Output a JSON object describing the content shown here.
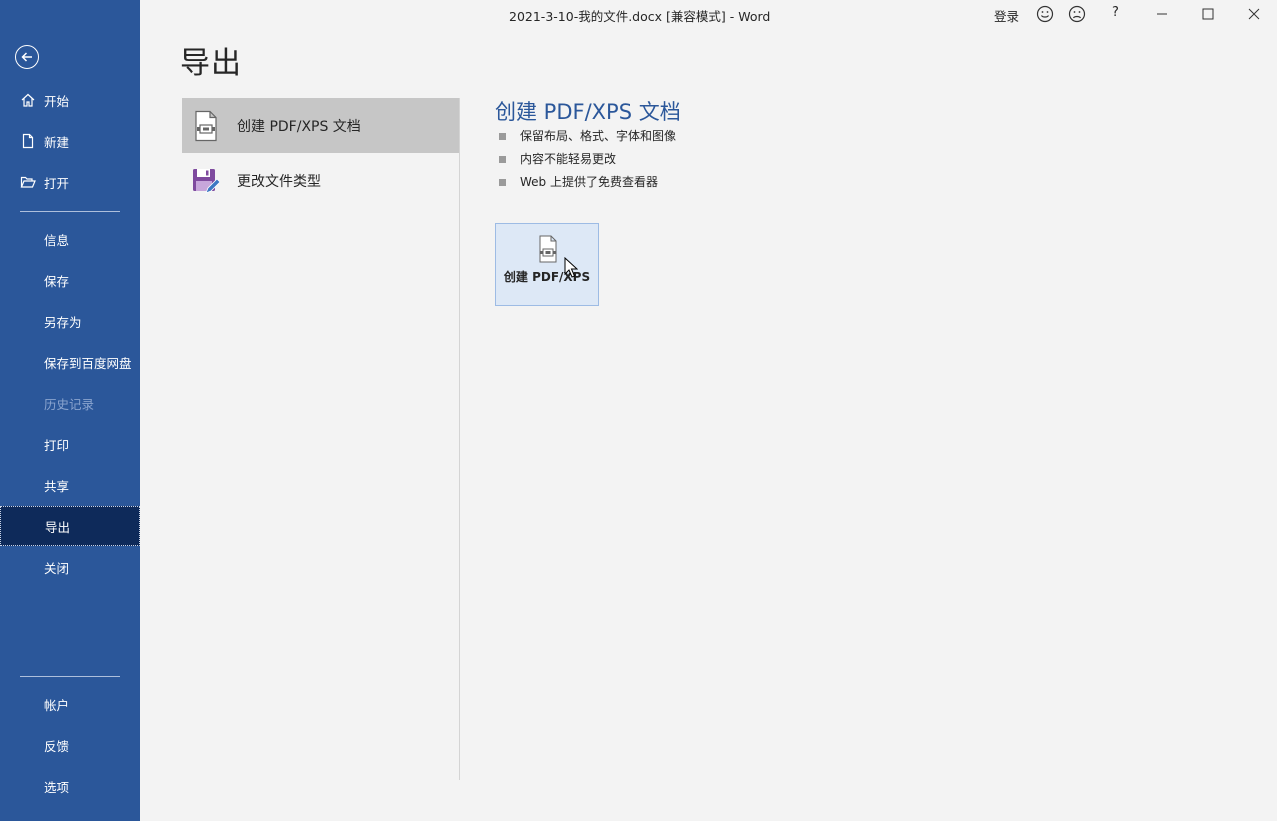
{
  "window": {
    "title": "2021-3-10-我的文件.docx [兼容模式]  -  Word",
    "login": "登录",
    "help": "?"
  },
  "sidebar": {
    "top_items": [
      {
        "label": "开始",
        "icon": "home-icon"
      },
      {
        "label": "新建",
        "icon": "new-document-icon"
      },
      {
        "label": "打开",
        "icon": "open-folder-icon"
      }
    ],
    "mid_items": [
      {
        "label": "信息"
      },
      {
        "label": "保存"
      },
      {
        "label": "另存为"
      },
      {
        "label": "保存到百度网盘"
      },
      {
        "label": "历史记录",
        "disabled": true
      },
      {
        "label": "打印"
      },
      {
        "label": "共享"
      },
      {
        "label": "导出",
        "active": true
      },
      {
        "label": "关闭"
      }
    ],
    "bottom_items": [
      {
        "label": "帐户"
      },
      {
        "label": "反馈"
      },
      {
        "label": "选项"
      }
    ]
  },
  "main": {
    "page_title": "导出",
    "options": [
      {
        "label": "创建 PDF/XPS 文档",
        "selected": true
      },
      {
        "label": "更改文件类型"
      }
    ],
    "detail": {
      "title": "创建 PDF/XPS 文档",
      "bullets": [
        "保留布局、格式、字体和图像",
        "内容不能轻易更改",
        "Web 上提供了免费查看器"
      ],
      "button_label": "创建 PDF/XPS"
    }
  },
  "colors": {
    "sidebar_bg": "#2b579a",
    "active_bg": "#0e2a5a",
    "accent": "#2b579a",
    "selected_option": "#c6c6c6"
  }
}
